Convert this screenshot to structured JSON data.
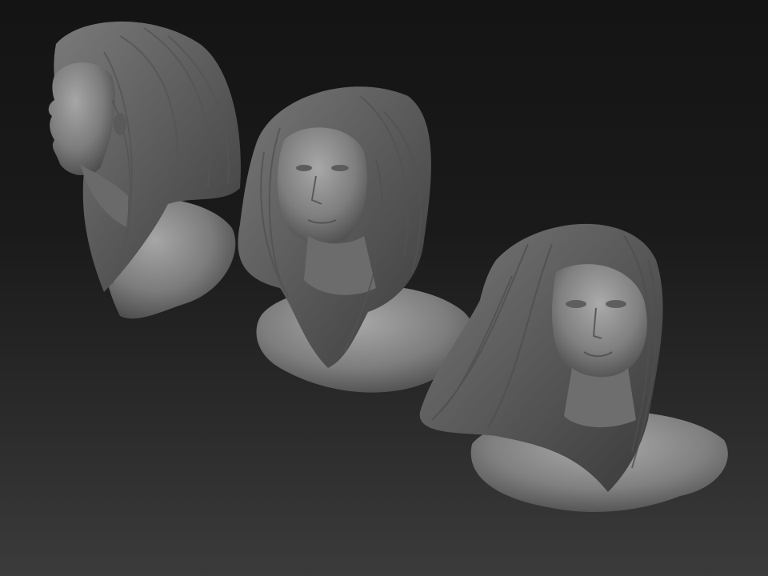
{
  "scene": {
    "background_top": "#141414",
    "background_bottom": "#3b3b3b",
    "material_color": "#8a8a8a"
  },
  "busts": [
    {
      "view": "side profile"
    },
    {
      "view": "three-quarter"
    },
    {
      "view": "front"
    }
  ]
}
